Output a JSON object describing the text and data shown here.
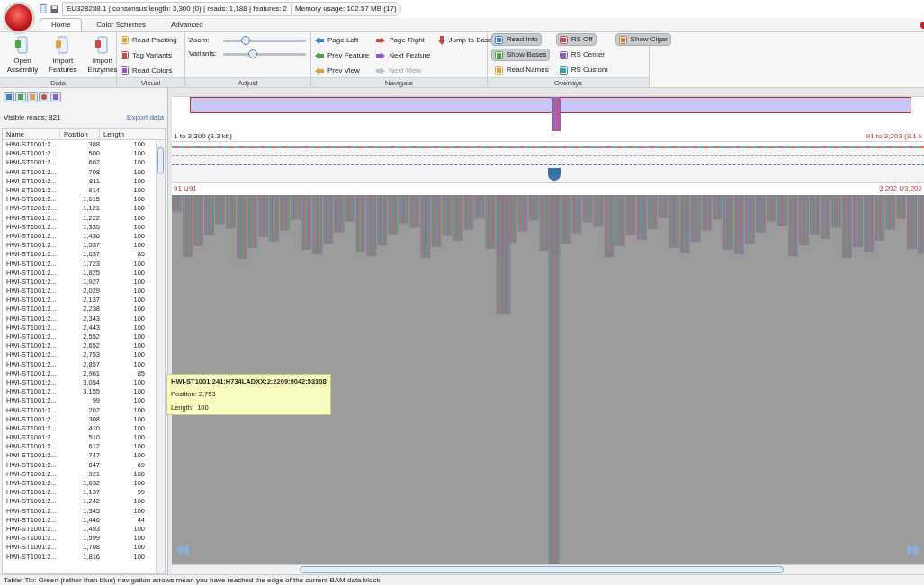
{
  "title_bar": {
    "info": "EU328288.1 | consensus length: 3,300 (0) | reads: 1,188 | features: 2",
    "memory": "Memory usage: 102.57 MB (17)"
  },
  "tabs": [
    {
      "label": "Home",
      "selected": true
    },
    {
      "label": "Color Schemes",
      "selected": false
    },
    {
      "label": "Advanced",
      "selected": false
    }
  ],
  "ribbon": [
    {
      "label": "Data",
      "kind": "large",
      "items": [
        {
          "label": "Open Assembly"
        },
        {
          "label": "Import Features"
        },
        {
          "label": "Import Enzymes"
        }
      ]
    },
    {
      "label": "Visual",
      "kind": "list",
      "items": [
        {
          "label": "Read Packing"
        },
        {
          "label": "Tag Variants"
        },
        {
          "label": "Read Colors"
        }
      ]
    },
    {
      "label": "Adjust",
      "kind": "sliders",
      "items": [
        {
          "label": "Zoom:",
          "level": 0.27
        },
        {
          "label": "Variants:",
          "level": 0.36
        }
      ]
    },
    {
      "label": "Navigate",
      "kind": "nav",
      "items": [
        {
          "label": "Page Left",
          "disabled": false
        },
        {
          "label": "Prev Feature",
          "disabled": false
        },
        {
          "label": "Prev View",
          "disabled": false
        },
        {
          "label": "Page Right",
          "disabled": false
        },
        {
          "label": "Next Feature",
          "disabled": false
        },
        {
          "label": "Next View",
          "disabled": true
        },
        {
          "label": "Jump to Base",
          "disabled": false
        }
      ]
    },
    {
      "label": "Overlays",
      "kind": "toggles",
      "items": [
        {
          "label": "Read Info",
          "selected": true
        },
        {
          "label": "Show Bases",
          "selected": true
        },
        {
          "label": "Read Names",
          "selected": false
        },
        {
          "label": "RS Off",
          "selected": true
        },
        {
          "label": "RS Center",
          "selected": false
        },
        {
          "label": "RS Custom",
          "selected": false
        },
        {
          "label": "Show Cigar",
          "selected": true
        }
      ]
    }
  ],
  "reads_panel": {
    "visible": "Visible reads: 821",
    "export": "Export data",
    "columns": [
      "Name",
      "Position",
      "Length"
    ],
    "rows": [
      [
        "HWI-ST1001:2...",
        "388",
        "100"
      ],
      [
        "HWI-ST1001:2...",
        "500",
        "100"
      ],
      [
        "HWI-ST1001:2...",
        "602",
        "100"
      ],
      [
        "HWI-ST1001:2...",
        "708",
        "100"
      ],
      [
        "HWI-ST1001:2...",
        "811",
        "100"
      ],
      [
        "HWI-ST1001:2...",
        "914",
        "100"
      ],
      [
        "HWI-ST1001:2...",
        "1,015",
        "100"
      ],
      [
        "HWI-ST1001:2...",
        "1,121",
        "100"
      ],
      [
        "HWI-ST1001:2...",
        "1,222",
        "100"
      ],
      [
        "HWI-ST1001:2...",
        "1,335",
        "100"
      ],
      [
        "HWI-ST1001:2...",
        "1,436",
        "100"
      ],
      [
        "HWI-ST1001:2...",
        "1,537",
        "100"
      ],
      [
        "HWI-ST1001:2...",
        "1,637",
        "85"
      ],
      [
        "HWI-ST1001:2...",
        "1,723",
        "100"
      ],
      [
        "HWI-ST1001:2...",
        "1,825",
        "100"
      ],
      [
        "HWI-ST1001:2...",
        "1,927",
        "100"
      ],
      [
        "HWI-ST1001:2...",
        "2,029",
        "100"
      ],
      [
        "HWI-ST1001:2...",
        "2,137",
        "100"
      ],
      [
        "HWI-ST1001:2...",
        "2,238",
        "100"
      ],
      [
        "HWI-ST1001:2...",
        "2,343",
        "100"
      ],
      [
        "HWI-ST1001:2...",
        "2,443",
        "100"
      ],
      [
        "HWI-ST1001:2...",
        "2,552",
        "100"
      ],
      [
        "HWI-ST1001:2...",
        "2,652",
        "100"
      ],
      [
        "HWI-ST1001:2...",
        "2,753",
        "100"
      ],
      [
        "HWI-ST1001:2...",
        "2,857",
        "100"
      ],
      [
        "HWI-ST1001:2...",
        "2,961",
        "85"
      ],
      [
        "HWI-ST1001:2...",
        "3,054",
        "100"
      ],
      [
        "HWI-ST1001:2...",
        "3,155",
        "100"
      ],
      [
        "HWI-ST1001:2...",
        "99",
        "100"
      ],
      [
        "HWI-ST1001:2...",
        "202",
        "100"
      ],
      [
        "HWI-ST1001:2...",
        "308",
        "100"
      ],
      [
        "HWI-ST1001:2...",
        "410",
        "100"
      ],
      [
        "HWI-ST1001:2...",
        "510",
        "100"
      ],
      [
        "HWI-ST1001:2...",
        "612",
        "100"
      ],
      [
        "HWI-ST1001:2...",
        "747",
        "100"
      ],
      [
        "HWI-ST1001:2...",
        "847",
        "69"
      ],
      [
        "HWI-ST1001:2...",
        "921",
        "100"
      ],
      [
        "HWI-ST1001:2...",
        "1,032",
        "100"
      ],
      [
        "HWI-ST1001:2...",
        "1,137",
        "99"
      ],
      [
        "HWI-ST1001:2...",
        "1,242",
        "100"
      ],
      [
        "HWI-ST1001:2...",
        "1,345",
        "100"
      ],
      [
        "HWI-ST1001:2...",
        "1,446",
        "44"
      ],
      [
        "HWI-ST1001:2...",
        "1,493",
        "100"
      ],
      [
        "HWI-ST1001:2...",
        "1,599",
        "100"
      ],
      [
        "HWI-ST1001:2...",
        "1,708",
        "100"
      ],
      [
        "HWI-ST1001:2...",
        "1,816",
        "100"
      ]
    ]
  },
  "view": {
    "range_left": "1 to 3,300 (3.3 kb)",
    "range_right": "91 to 3,203 (3.1 k",
    "pos_left": "91 U91",
    "pos_right": "3,202 U3,202"
  },
  "tooltip": {
    "title": "HWI-ST1001:241:H734LADXX:2:2209:9042:53108",
    "lines": [
      "Position: 2,753",
      "Length:  100"
    ]
  },
  "status": "Tablet Tip: Green (rather than blue) navigation arrows mean you have reached the edge of the current BAM data block"
}
